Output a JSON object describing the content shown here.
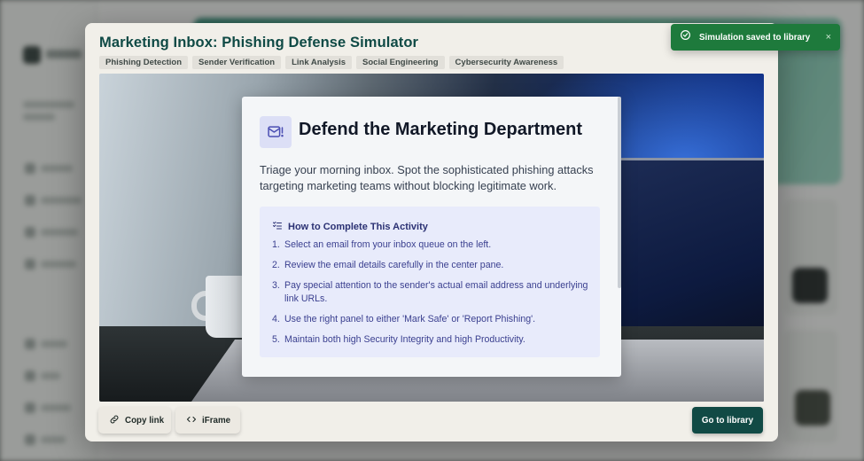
{
  "modal": {
    "title": "Marketing Inbox: Phishing Defense Simulator",
    "tags": [
      "Phishing Detection",
      "Sender Verification",
      "Link Analysis",
      "Social Engineering",
      "Cybersecurity Awareness"
    ]
  },
  "card": {
    "icon": "mail-alert-icon",
    "title": "Defend the Marketing Department",
    "description": "Triage your morning inbox. Spot the sophisticated phishing attacks targeting marketing teams without blocking legitimate work.",
    "how_to": {
      "icon": "checklist-icon",
      "title": "How to Complete This Activity",
      "steps": [
        {
          "num": "1.",
          "text": "Select an email from your inbox queue on the left."
        },
        {
          "num": "2.",
          "text": "Review the email details carefully in the center pane."
        },
        {
          "num": "3.",
          "text": "Pay special attention to the sender's actual email address and underlying link URLs."
        },
        {
          "num": "4.",
          "text": "Use the right panel to either 'Mark Safe' or 'Report Phishing'."
        },
        {
          "num": "5.",
          "text": "Maintain both high Security Integrity and high Productivity."
        }
      ]
    }
  },
  "footer": {
    "copy_link": "Copy link",
    "iframe": "iFrame",
    "go_to_library": "Go to library"
  },
  "toast": {
    "message": "Simulation saved to library",
    "close": "×"
  },
  "colors": {
    "title": "#0f4a45",
    "primary_button": "#114a45",
    "toast": "#1e7a3c",
    "how_to_box": "#e8ebfb"
  }
}
